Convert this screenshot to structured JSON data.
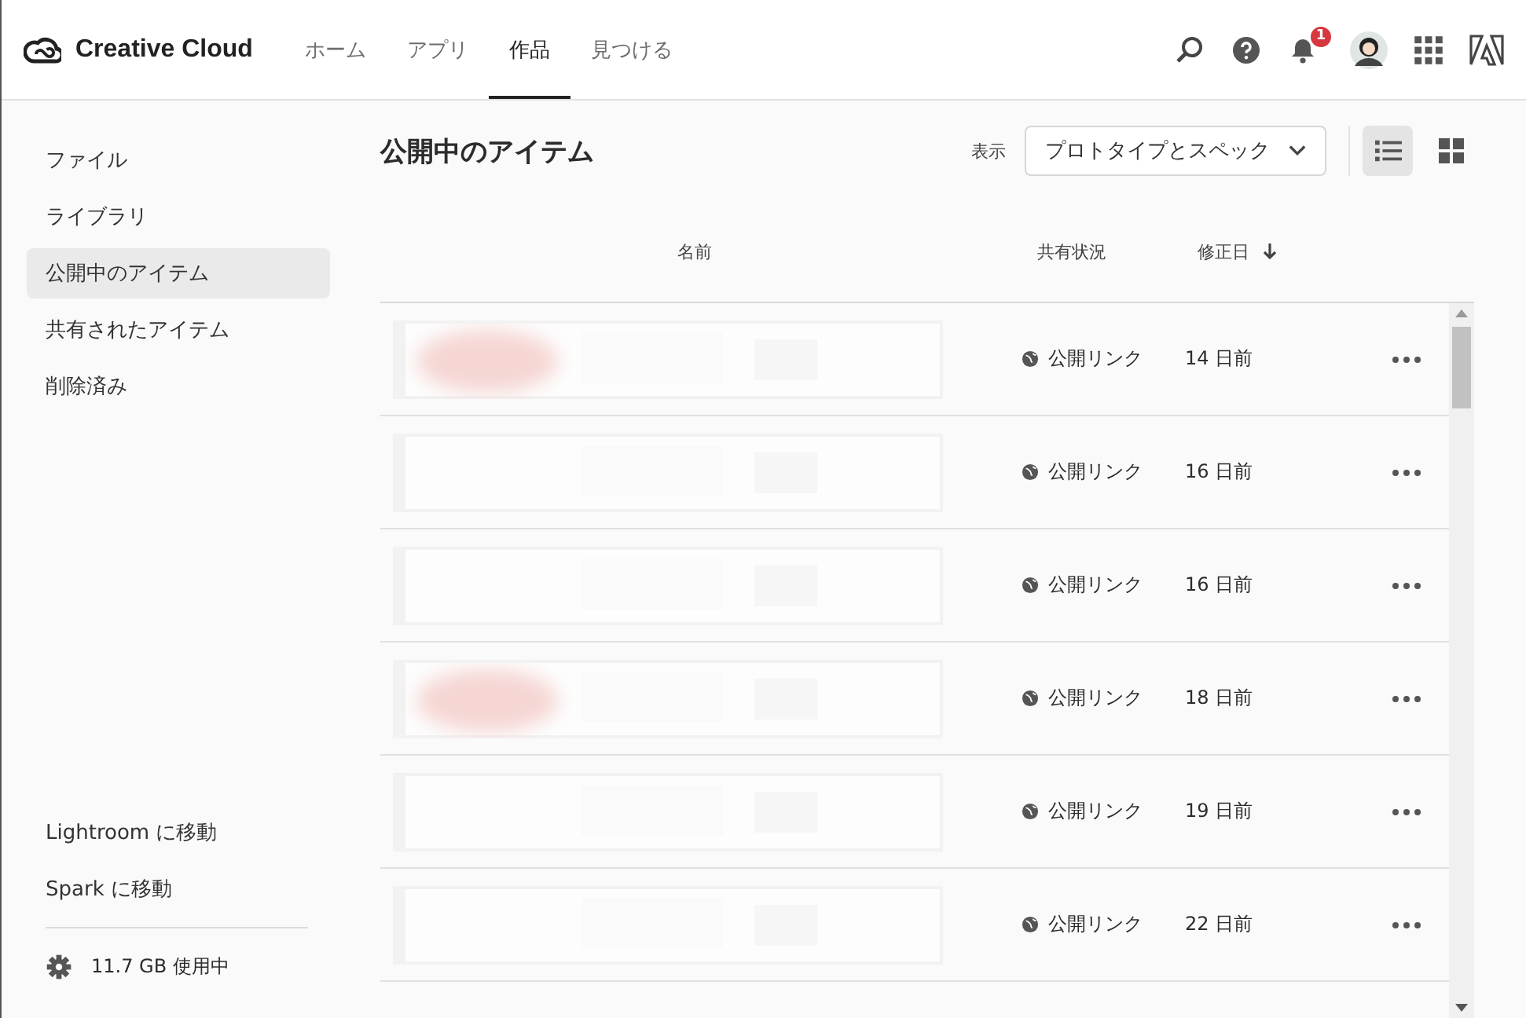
{
  "header": {
    "brand": "Creative Cloud",
    "nav": [
      {
        "label": "ホーム",
        "selected": false
      },
      {
        "label": "アプリ",
        "selected": false
      },
      {
        "label": "作品",
        "selected": true
      },
      {
        "label": "見つける",
        "selected": false
      }
    ],
    "notification_count": "1"
  },
  "sidebar": {
    "items": [
      {
        "label": "ファイル",
        "selected": false
      },
      {
        "label": "ライブラリ",
        "selected": false
      },
      {
        "label": "公開中のアイテム",
        "selected": true
      },
      {
        "label": "共有されたアイテム",
        "selected": false
      },
      {
        "label": "削除済み",
        "selected": false
      }
    ],
    "links": [
      "Lightroom に移動",
      "Spark に移動"
    ],
    "storage": "11.7 GB 使用中"
  },
  "main": {
    "title": "公開中のアイテム",
    "view_label": "表示",
    "view_select": "プロトタイプとスペック",
    "views": [
      {
        "kind": "list",
        "selected": true
      },
      {
        "kind": "grid",
        "selected": false
      }
    ],
    "columns": [
      "名前",
      "共有状況",
      "修正日"
    ],
    "rows": [
      {
        "kind": "picture",
        "share": "公開リンク",
        "modified": "14 日前"
      },
      {
        "kind": "picture",
        "share": "公開リンク",
        "modified": "16 日前"
      },
      {
        "kind": "picture",
        "share": "公開リンク",
        "modified": "16 日前"
      },
      {
        "kind": "picture",
        "share": "公開リンク",
        "modified": "18 日前"
      },
      {
        "kind": "picture",
        "share": "公開リンク",
        "modified": "19 日前"
      },
      {
        "kind": "picture",
        "share": "公開リンク",
        "modified": "22 日前"
      }
    ]
  }
}
